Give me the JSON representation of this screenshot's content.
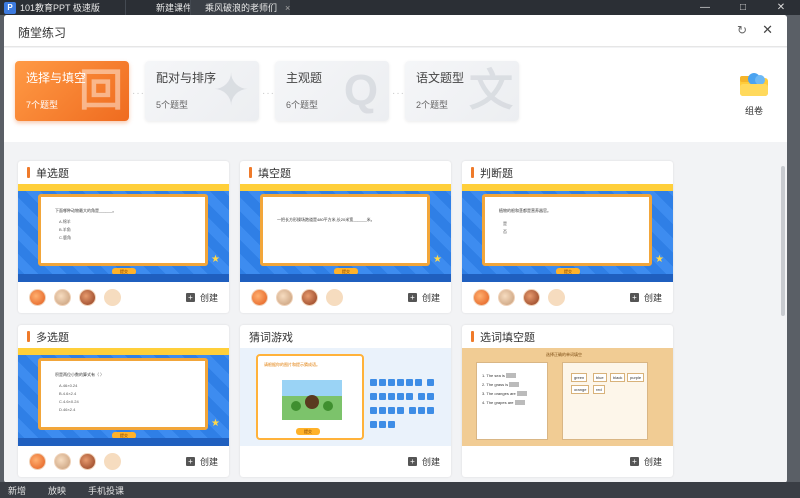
{
  "app": {
    "title": "101教育PPT 极速版",
    "tabs": [
      {
        "label": "新建课件"
      },
      {
        "label": "乘风破浪的老师们"
      }
    ],
    "controls": [
      "—",
      "□",
      "✕"
    ]
  },
  "dialog": {
    "title": "随堂练习",
    "refresh_icon": "↻",
    "close_icon": "✕"
  },
  "categories": [
    {
      "name": "选择与填空",
      "count": "7个题型",
      "active": true,
      "deco": "回"
    },
    {
      "name": "配对与排序",
      "count": "5个题型",
      "active": false,
      "deco": "✦"
    },
    {
      "name": "主观题",
      "count": "6个题型",
      "active": false,
      "deco": "Q"
    },
    {
      "name": "语文题型",
      "count": "2个题型",
      "active": false,
      "deco": "文"
    }
  ],
  "compose": {
    "label": "组卷"
  },
  "cards": [
    {
      "title": "单选题",
      "create": "创建",
      "slide": {
        "question": "下面哪种动物最大的角是______。",
        "options": [
          "A.绵羊",
          "B.羊角",
          "C.鹿角"
        ],
        "button": "提交"
      }
    },
    {
      "title": "填空题",
      "create": "创建",
      "slide": {
        "question": "一把长方形操场跑道是480平方米,长20米宽______米。",
        "options": [],
        "button": "提交"
      }
    },
    {
      "title": "判断题",
      "create": "创建",
      "slide": {
        "question": "植物的根和茎都是营养器官。",
        "options": [
          "是",
          "否"
        ],
        "button": "提交"
      }
    },
    {
      "title": "多选题",
      "create": "创建",
      "slide": {
        "question": "积是两位小数的算式有（ ）",
        "options": [
          "A.46×0.24",
          "B.4.6×2.4",
          "C.4.6×0.24",
          "D.46×2.4"
        ],
        "button": "提交"
      }
    },
    {
      "title": "猜词游戏",
      "create": "创建",
      "slide": {
        "question": "请根据你的图片和提示猜成语。",
        "options": [],
        "button": "提交"
      }
    },
    {
      "title": "选词填空题",
      "create": "创建",
      "slide": {
        "question": "选择正确的单词填空",
        "options": [
          "1. The sea is",
          "2. The grass is",
          "3. The oranges are",
          "4. The grapes are"
        ],
        "words": [
          "green",
          "blue",
          "black",
          "purple",
          "orange",
          "red"
        ],
        "button": "提交"
      }
    }
  ],
  "bottom_bar": [
    "新增",
    "放映",
    "手机投课"
  ]
}
